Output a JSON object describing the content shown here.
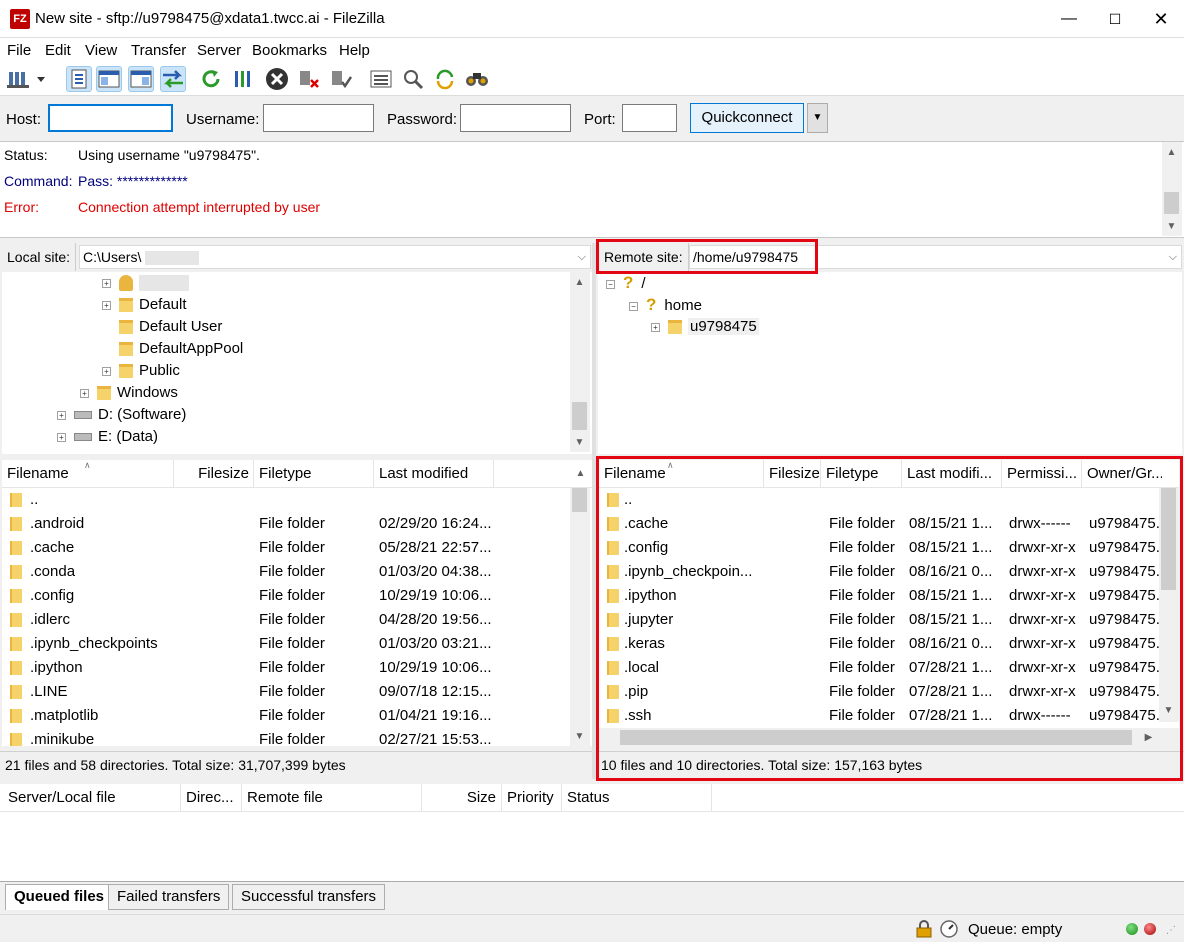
{
  "window": {
    "title": "New site - sftp://u9798475@xdata1.twcc.ai - FileZilla",
    "app_icon_text": "FZ"
  },
  "menu": [
    "File",
    "Edit",
    "View",
    "Transfer",
    "Server",
    "Bookmarks",
    "Help"
  ],
  "quickconnect": {
    "host_label": "Host:",
    "host_value": "",
    "username_label": "Username:",
    "username_value": "",
    "password_label": "Password:",
    "password_value": "",
    "port_label": "Port:",
    "port_value": "",
    "button": "Quickconnect"
  },
  "log": [
    {
      "key": "Status:",
      "value": "Using username \"u9798475\".",
      "color": "#000000"
    },
    {
      "key": "Command:",
      "value": "Pass: *************",
      "color": "#00007f"
    },
    {
      "key": "Error:",
      "value": "Connection attempt interrupted by user",
      "color": "#e00000"
    }
  ],
  "local": {
    "label": "Local site:",
    "path": "C:\\Users\\",
    "tree": [
      {
        "label": "",
        "indent": 2,
        "expand": true,
        "icon": "user-icon"
      },
      {
        "label": "Default",
        "indent": 2,
        "expand": true,
        "icon": "folder-icon"
      },
      {
        "label": "Default User",
        "indent": 2,
        "expand": false,
        "icon": "folder-icon"
      },
      {
        "label": "DefaultAppPool",
        "indent": 2,
        "expand": false,
        "icon": "folder-icon"
      },
      {
        "label": "Public",
        "indent": 2,
        "expand": true,
        "icon": "folder-icon"
      },
      {
        "label": "Windows",
        "indent": 1,
        "expand": true,
        "icon": "folder-icon"
      },
      {
        "label": "D: (Software)",
        "indent": 0,
        "expand": true,
        "icon": "drive-icon"
      },
      {
        "label": "E: (Data)",
        "indent": 0,
        "expand": true,
        "icon": "drive-icon"
      }
    ],
    "columns": [
      "Filename",
      "Filesize",
      "Filetype",
      "Last modified"
    ],
    "files": [
      {
        "name": "..",
        "type": "",
        "modified": ""
      },
      {
        "name": ".android",
        "type": "File folder",
        "modified": "02/29/20 16:24..."
      },
      {
        "name": ".cache",
        "type": "File folder",
        "modified": "05/28/21 22:57..."
      },
      {
        "name": ".conda",
        "type": "File folder",
        "modified": "01/03/20 04:38..."
      },
      {
        "name": ".config",
        "type": "File folder",
        "modified": "10/29/19 10:06..."
      },
      {
        "name": ".idlerc",
        "type": "File folder",
        "modified": "04/28/20 19:56..."
      },
      {
        "name": ".ipynb_checkpoints",
        "type": "File folder",
        "modified": "01/03/20 03:21..."
      },
      {
        "name": ".ipython",
        "type": "File folder",
        "modified": "10/29/19 10:06..."
      },
      {
        "name": ".LINE",
        "type": "File folder",
        "modified": "09/07/18 12:15..."
      },
      {
        "name": ".matplotlib",
        "type": "File folder",
        "modified": "01/04/21 19:16..."
      },
      {
        "name": ".minikube",
        "type": "File folder",
        "modified": "02/27/21 15:53..."
      }
    ],
    "status": "21 files and 58 directories. Total size: 31,707,399 bytes"
  },
  "remote": {
    "label": "Remote site:",
    "path": "/home/u9798475",
    "tree": [
      {
        "label": "/",
        "indent": 0,
        "expand": true,
        "icon": "question-icon"
      },
      {
        "label": "home",
        "indent": 1,
        "expand": true,
        "icon": "question-icon"
      },
      {
        "label": "u9798475",
        "indent": 2,
        "expand": true,
        "icon": "folder-icon"
      }
    ],
    "columns": [
      "Filename",
      "Filesize",
      "Filetype",
      "Last modifi...",
      "Permissi...",
      "Owner/Gr..."
    ],
    "files": [
      {
        "name": "..",
        "type": "",
        "modified": "",
        "perm": "",
        "owner": ""
      },
      {
        "name": ".cache",
        "type": "File folder",
        "modified": "08/15/21 1...",
        "perm": "drwx------",
        "owner": "u9798475..."
      },
      {
        "name": ".config",
        "type": "File folder",
        "modified": "08/15/21 1...",
        "perm": "drwxr-xr-x",
        "owner": "u9798475..."
      },
      {
        "name": ".ipynb_checkpoin...",
        "type": "File folder",
        "modified": "08/16/21 0...",
        "perm": "drwxr-xr-x",
        "owner": "u9798475..."
      },
      {
        "name": ".ipython",
        "type": "File folder",
        "modified": "08/15/21 1...",
        "perm": "drwxr-xr-x",
        "owner": "u9798475..."
      },
      {
        "name": ".jupyter",
        "type": "File folder",
        "modified": "08/15/21 1...",
        "perm": "drwxr-xr-x",
        "owner": "u9798475..."
      },
      {
        "name": ".keras",
        "type": "File folder",
        "modified": "08/16/21 0...",
        "perm": "drwxr-xr-x",
        "owner": "u9798475..."
      },
      {
        "name": ".local",
        "type": "File folder",
        "modified": "07/28/21 1...",
        "perm": "drwxr-xr-x",
        "owner": "u9798475..."
      },
      {
        "name": ".pip",
        "type": "File folder",
        "modified": "07/28/21 1...",
        "perm": "drwxr-xr-x",
        "owner": "u9798475..."
      },
      {
        "name": ".ssh",
        "type": "File folder",
        "modified": "07/28/21 1...",
        "perm": "drwx------",
        "owner": "u9798475..."
      }
    ],
    "status": "10 files and 10 directories. Total size: 157,163 bytes"
  },
  "queue": {
    "columns": [
      "Server/Local file",
      "Direc...",
      "Remote file",
      "Size",
      "Priority",
      "Status"
    ],
    "tabs": [
      "Queued files",
      "Failed transfers",
      "Successful transfers"
    ],
    "status": "Queue: empty"
  },
  "colors": {
    "highlight": "#e30613",
    "accent": "#0078d7",
    "error": "#e00000",
    "command": "#00007f"
  }
}
